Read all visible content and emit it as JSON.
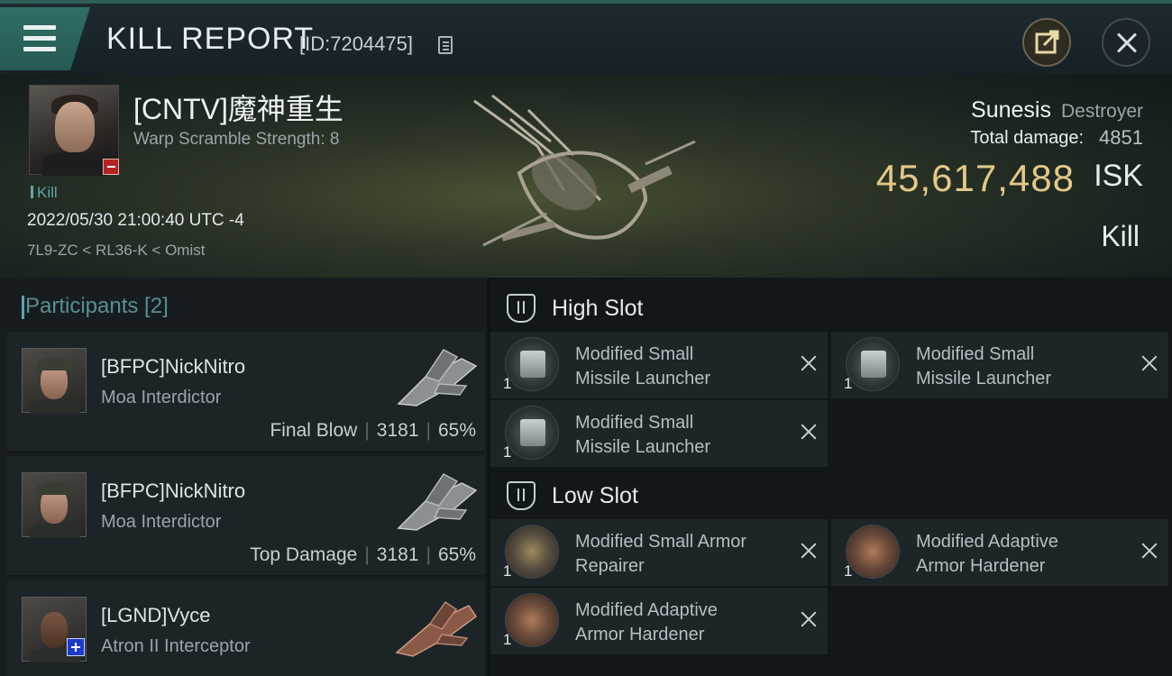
{
  "header": {
    "title": "KILL REPORT",
    "id": "[ID:7204475]"
  },
  "victim": {
    "name": "[CNTV]魔神重生",
    "scramble": "Warp Scramble Strength: 8",
    "tag": "Kill",
    "timestamp": "2022/05/30 21:00:40 UTC -4",
    "location": "7L9-ZC < RL36-K < Omist",
    "ship_name": "Sunesis",
    "ship_class": "Destroyer",
    "total_damage_label": "Total damage:",
    "total_damage": "4851",
    "isk_value": "45,617,488",
    "isk_label": "ISK",
    "result": "Kill"
  },
  "participants": {
    "header": "Participants [2]",
    "items": [
      {
        "name": "[BFPC]NickNitro",
        "ship": "Moa Interdictor",
        "label": "Final Blow",
        "damage": "3181",
        "percent": "65%"
      },
      {
        "name": "[BFPC]NickNitro",
        "ship": "Moa Interdictor",
        "label": "Top Damage",
        "damage": "3181",
        "percent": "65%"
      },
      {
        "name": "[LGND]Vyce",
        "ship": "Atron II Interceptor"
      }
    ]
  },
  "fittings": {
    "high_slot": {
      "title": "High Slot",
      "modules": [
        {
          "line1": "Modified Small",
          "line2": "Missile Launcher",
          "qty": "1"
        },
        {
          "line1": "Modified Small",
          "line2": "Missile Launcher",
          "qty": "1"
        },
        {
          "line1": "Modified Small",
          "line2": "Missile Launcher",
          "qty": "1"
        }
      ]
    },
    "low_slot": {
      "title": "Low Slot",
      "modules": [
        {
          "line1": "Modified Small Armor",
          "line2": "Repairer",
          "qty": "1"
        },
        {
          "line1": "Modified Adaptive",
          "line2": "Armor Hardener",
          "qty": "1"
        },
        {
          "line1": "Modified Adaptive",
          "line2": "Armor Hardener",
          "qty": "1"
        }
      ]
    }
  },
  "colors": {
    "accent_teal": "#5fa3a6",
    "isk_gold": "#e3c889",
    "minus_badge": "#b22323",
    "plus_badge": "#1d3bc7"
  }
}
